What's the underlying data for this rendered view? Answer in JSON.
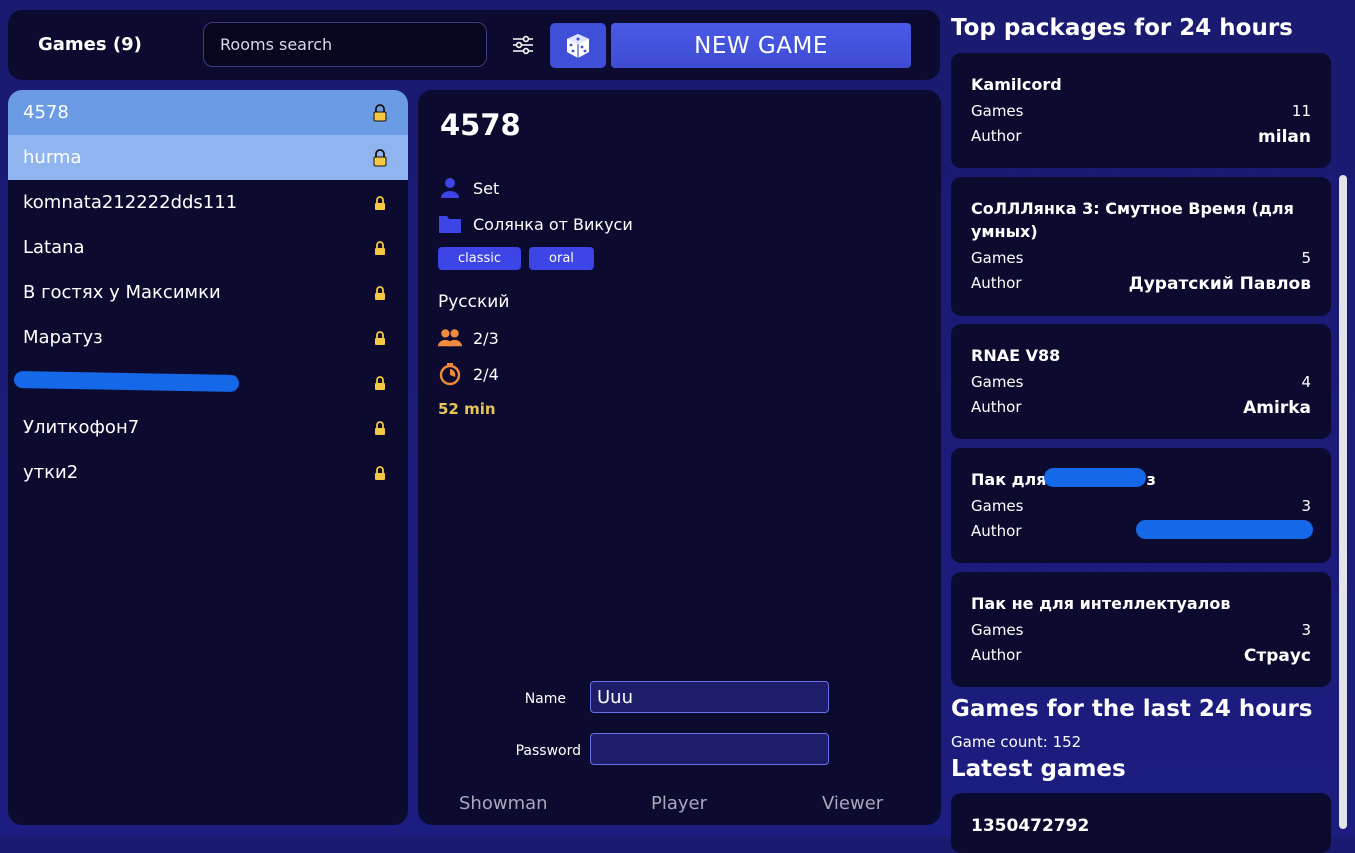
{
  "header": {
    "games_title": "Games (9)",
    "search_placeholder": "Rooms search",
    "new_game_label": "NEW GAME"
  },
  "rooms": [
    {
      "name": "4578"
    },
    {
      "name": "hurma"
    },
    {
      "name": "komnata212222dds111"
    },
    {
      "name": "Latana"
    },
    {
      "name": "В гостях у Максимки"
    },
    {
      "name": "Маратуз"
    },
    {
      "name": ""
    },
    {
      "name": "Улиткофон7"
    },
    {
      "name": "утки2"
    }
  ],
  "details": {
    "title": "4578",
    "host": "Set",
    "package": "Солянка от Викуси",
    "tags": [
      "classic",
      "oral"
    ],
    "language": "Русский",
    "players": "2/3",
    "rounds": "2/4",
    "duration": "52 min",
    "name_label": "Name",
    "name_value": "Uuu",
    "password_label": "Password",
    "password_value": "",
    "roles": [
      "Showman",
      "Player",
      "Viewer"
    ]
  },
  "top_packages": {
    "title": "Top packages for 24 hours",
    "games_label": "Games",
    "author_label": "Author",
    "items": [
      {
        "name": "Kamilcord",
        "games": "11",
        "author": "milan"
      },
      {
        "name": "СоЛЛЛянка 3: Смутное Время (для умных)",
        "games": "5",
        "author": "Дуратский Павлов"
      },
      {
        "name": "RNAE V88",
        "games": "4",
        "author": "Amirka"
      },
      {
        "name": "Пак для",
        "name_suffix": "з",
        "games": "3",
        "author": ""
      },
      {
        "name": "Пак не для интеллектуалов",
        "games": "3",
        "author": "Страус"
      }
    ]
  },
  "games_last_24": {
    "title": "Games for the last 24 hours",
    "count_text": "Game count: 152"
  },
  "latest_games": {
    "title": "Latest games",
    "first": "1350472792"
  },
  "colors": {
    "background": "#1b1a78",
    "panel": "#0c0b2f",
    "accent": "#3f4fd8",
    "selected_room": "#6b9be5",
    "hover_room": "#8fb4f0",
    "lock": "#f5c842",
    "duration": "#e6c45c",
    "orange_icon": "#f08a3c",
    "redaction": "#1568e8"
  }
}
